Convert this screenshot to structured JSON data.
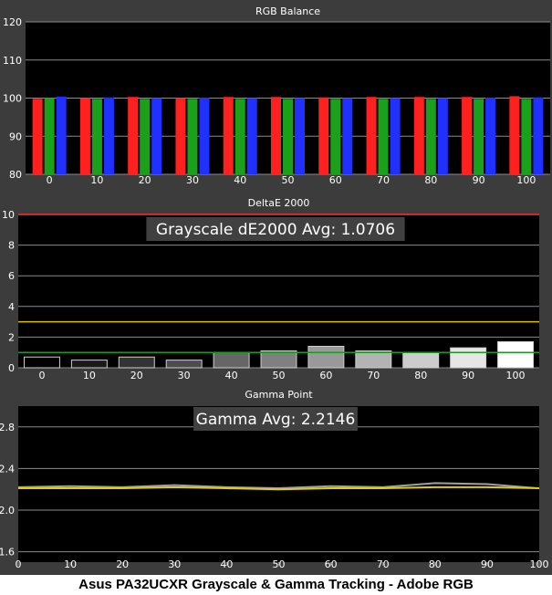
{
  "caption": "Asus PA32UCXR Grayscale & Gamma Tracking - Adobe RGB",
  "colors": {
    "background": "#3c3c3c",
    "plot_background": "#000000",
    "grid": "#8a8a8a",
    "text": "#ffffff",
    "red": "#ff2020",
    "green": "#1aa01a",
    "blue": "#2030ff",
    "threshold_red": "#ff3030",
    "threshold_yellow": "#d8c000",
    "threshold_green": "#1a9a1a",
    "gamma_line": "#e0d000",
    "gamma_target": "#a0a0a0"
  },
  "chart_data": [
    {
      "type": "bar",
      "title": "RGB Balance",
      "categories": [
        "0",
        "10",
        "20",
        "30",
        "40",
        "50",
        "60",
        "70",
        "80",
        "90",
        "100"
      ],
      "ylim": [
        80,
        120
      ],
      "yticks": [
        80,
        90,
        100,
        110,
        120
      ],
      "grid": true,
      "series": [
        {
          "color": "red",
          "values": [
            99.8,
            100.0,
            100.3,
            100.0,
            100.3,
            100.3,
            100.2,
            100.3,
            100.3,
            100.3,
            100.5
          ]
        },
        {
          "color": "green",
          "values": [
            100.0,
            99.8,
            99.8,
            99.8,
            99.8,
            99.8,
            99.8,
            99.8,
            99.8,
            99.8,
            99.8
          ]
        },
        {
          "color": "blue",
          "values": [
            100.4,
            100.2,
            100.0,
            100.1,
            100.0,
            100.0,
            100.0,
            100.0,
            100.0,
            100.1,
            100.2
          ]
        }
      ]
    },
    {
      "type": "bar",
      "title": "DeltaE 2000",
      "annotation": "Grayscale dE2000 Avg: 1.0706",
      "categories": [
        "0",
        "10",
        "20",
        "30",
        "40",
        "50",
        "60",
        "70",
        "80",
        "90",
        "100"
      ],
      "values": [
        0.7,
        0.5,
        0.7,
        0.5,
        1.0,
        1.1,
        1.4,
        1.1,
        1.0,
        1.3,
        1.7
      ],
      "shades": [
        "#000000",
        "#1a1a1a",
        "#333333",
        "#4d4d4d",
        "#666666",
        "#808080",
        "#999999",
        "#b3b3b3",
        "#cccccc",
        "#e6e6e6",
        "#ffffff"
      ],
      "ylim": [
        0,
        10
      ],
      "yticks": [
        0,
        2,
        4,
        6,
        8,
        10
      ],
      "thresholds": [
        {
          "value": 10,
          "color": "threshold_red"
        },
        {
          "value": 3,
          "color": "threshold_yellow"
        },
        {
          "value": 1,
          "color": "threshold_green"
        }
      ],
      "grid": true
    },
    {
      "type": "line",
      "title": "Gamma Point",
      "annotation": "Gamma Avg: 2.2146",
      "x": [
        0,
        10,
        20,
        30,
        40,
        50,
        60,
        70,
        80,
        90,
        100
      ],
      "xticks": [
        0,
        10,
        20,
        30,
        40,
        50,
        60,
        70,
        80,
        90,
        100
      ],
      "xlim": [
        0,
        100
      ],
      "ylim": [
        1.5,
        3.0
      ],
      "yticks": [
        1.6,
        2.0,
        2.4,
        2.8
      ],
      "grid": true,
      "series": [
        {
          "color": "gamma_line",
          "values": [
            2.21,
            2.21,
            2.21,
            2.22,
            2.21,
            2.2,
            2.21,
            2.21,
            2.22,
            2.22,
            2.21
          ]
        },
        {
          "color": "gamma_target",
          "values": [
            2.22,
            2.23,
            2.22,
            2.24,
            2.22,
            2.21,
            2.23,
            2.22,
            2.26,
            2.25,
            2.21
          ]
        }
      ]
    }
  ]
}
